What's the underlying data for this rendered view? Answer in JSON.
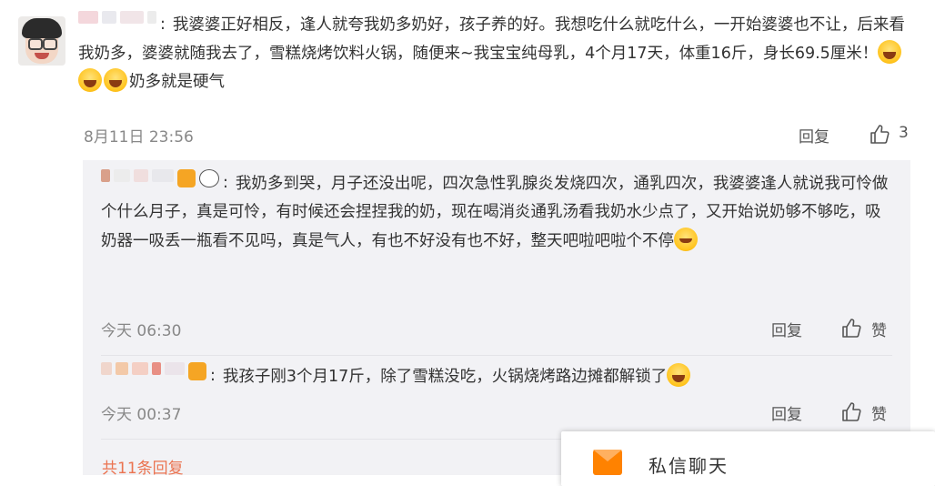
{
  "main_comment": {
    "text_before_emoji": "我婆婆正好相反，逢人就夸我奶多奶好，孩子养的好。我想吃什么就吃什么，一开始婆婆也不让，后来看我奶多，婆婆就随我去了，雪糕烧烤饮料火锅，随便来~我宝宝纯母乳，4个月17天，体重16斤，身长69.5厘米！",
    "text_after_emoji": "奶多就是硬气",
    "timestamp": "8月11日 23:56",
    "reply_label": "回复",
    "like_count": "3"
  },
  "replies": [
    {
      "text": "我奶多到哭，月子还没出呢，四次急性乳腺炎发烧四次，通乳四次，我婆婆逢人就说我可怜做个什么月子，真是可怜，有时候还会捏捏我的奶，现在喝消炎通乳汤看我奶水少点了，又开始说奶够不够吃，吸奶器一吸丢一瓶看不见吗，真是气人，有也不好没有也不好，整天吧啦吧啦个不停",
      "timestamp": "今天 06:30",
      "reply_label": "回复",
      "like_label": "赞"
    },
    {
      "text": "我孩子刚3个月17斤，除了雪糕没吃，火锅烧烤路边摊都解锁了",
      "timestamp": "今天 00:37",
      "reply_label": "回复",
      "like_label": "赞"
    }
  ],
  "total_replies": "共11条回复",
  "chat_widget": {
    "label": "私信聊天"
  },
  "colors": {
    "accent": "#eb7350",
    "reply_bg": "#f2f2f5",
    "chat_icon": "#ff8200"
  }
}
